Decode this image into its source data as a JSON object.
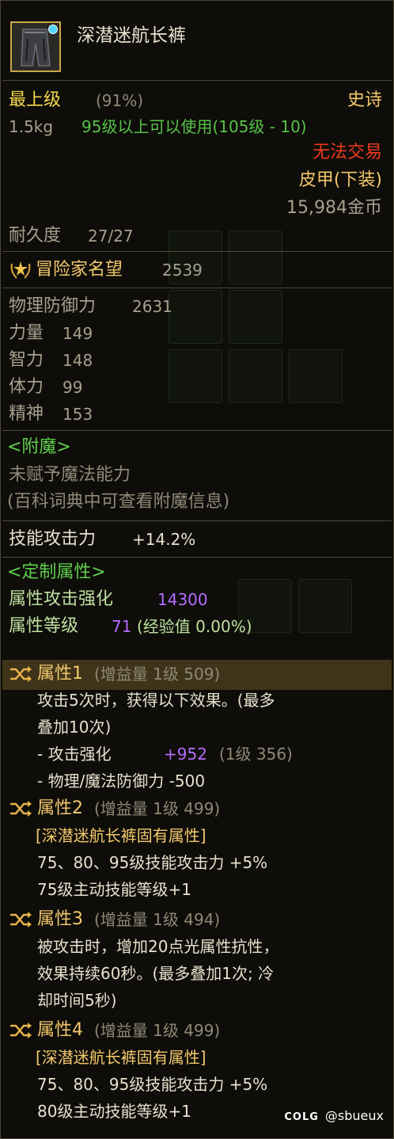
{
  "item": {
    "name": "深潜迷航长裤",
    "grade": "最上级",
    "grade_pct": "(91%)",
    "rarity": "史诗",
    "weight": "1.5kg",
    "level_req": "95级以上可以使用(105级 - 10)",
    "trade": "无法交易",
    "type": "皮甲(下装)",
    "price": "15,984金币",
    "durability_label": "耐久度",
    "durability": "27/27",
    "fame_label": "冒险家名望",
    "fame": "2539"
  },
  "stats": [
    {
      "label": "物理防御力",
      "value": "2631"
    },
    {
      "label": "力量",
      "value": "149"
    },
    {
      "label": "智力",
      "value": "148"
    },
    {
      "label": "体力",
      "value": "99"
    },
    {
      "label": "精神",
      "value": "153"
    }
  ],
  "enchant": {
    "title": "<附魔>",
    "line1": "未赋予魔法能力",
    "line2": "(百科词典中可查看附魔信息)"
  },
  "skill_atk": {
    "label": "技能攻击力",
    "value": "+14.2%"
  },
  "custom": {
    "title": "<定制属性>",
    "elem_label": "属性攻击强化",
    "elem_value": "14300",
    "lvl_label": "属性等级",
    "lvl_value": "71",
    "exp_text": "(经验值 0.00%)"
  },
  "attrs": [
    {
      "name": "属性1",
      "info": "(增益量 1级 509)",
      "lines": [
        "攻击5次时，获得以下效果。(最多",
        "叠加10次)"
      ],
      "sub1_label": "- 攻击强化",
      "sub1_value": "+952",
      "sub1_info": "(1级 356)",
      "sub2": "- 物理/魔法防御力 -500"
    },
    {
      "name": "属性2",
      "info": "(增益量 1级 499)",
      "tag": "[深潜迷航长裤固有属性]",
      "lines": [
        "75、80、95级技能攻击力 +5%",
        "75级主动技能等级+1"
      ]
    },
    {
      "name": "属性3",
      "info": "(增益量 1级 494)",
      "lines": [
        "被攻击时，增加20点光属性抗性，",
        "效果持续60秒。(最多叠加1次; 冷",
        "却时间5秒)"
      ]
    },
    {
      "name": "属性4",
      "info": "(增益量 1级 499)",
      "tag": "[深潜迷航长裤固有属性]",
      "lines": [
        "75、80、95级技能攻击力 +5%",
        "80级主动技能等级+1"
      ]
    }
  ],
  "watermark": {
    "logo": "COLG",
    "user": "@sbueux"
  },
  "colors": {
    "grade": "#f4d94c",
    "rarity": "#f2c86c",
    "trade": "#f03a1e",
    "level_req": "#57c248",
    "section_title": "#5fcf4e",
    "highlight": "#b46bff"
  },
  "icons": {
    "item": "dark-trousers-icon",
    "fame": "fame-laurel-icon",
    "attr": "shuffle-icon"
  }
}
